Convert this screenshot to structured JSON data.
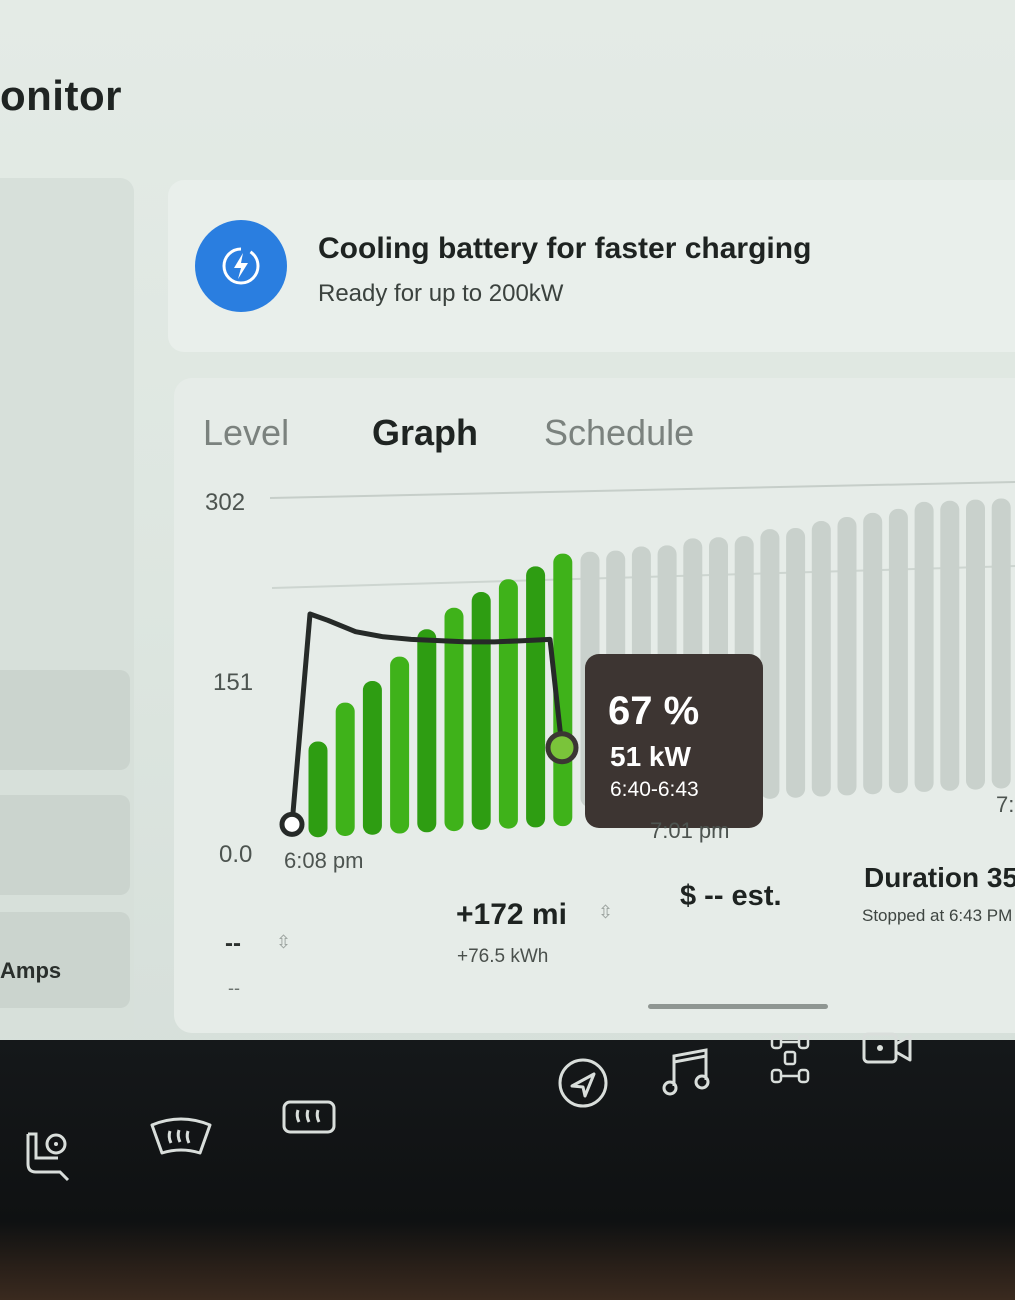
{
  "page": {
    "title": "onitor"
  },
  "sidebar": {
    "amps_label": "Amps"
  },
  "alert": {
    "title": "Cooling battery for faster charging",
    "subtitle": "Ready for up to 200kW",
    "icon": "battery-cooling-icon",
    "icon_color": "#2a7ee0"
  },
  "tabs": [
    {
      "label": "Level",
      "active": false
    },
    {
      "label": "Graph",
      "active": true
    },
    {
      "label": "Schedule",
      "active": false
    }
  ],
  "chart_data": {
    "type": "bar",
    "y_ticks": [
      "302",
      "151",
      "0.0"
    ],
    "ylim": [
      0,
      302
    ],
    "x_tick_labels": [
      "6:08 pm",
      "7:01 pm",
      "7:"
    ],
    "bar_levels_completed": [
      0.33,
      0.46,
      0.53,
      0.61,
      0.7,
      0.77,
      0.82,
      0.86,
      0.9,
      0.94
    ],
    "bar_levels_projected": [
      0.88,
      0.88,
      0.89,
      0.89,
      0.91,
      0.91,
      0.91,
      0.93,
      0.93,
      0.95,
      0.96,
      0.97,
      0.98,
      1.0,
      1.0,
      1.0,
      1.0,
      1.0,
      1.0
    ],
    "power_curve_kw": [
      0,
      166,
      160,
      150,
      145,
      142,
      140,
      138,
      137,
      137,
      137,
      51
    ],
    "colors": {
      "completed": "#3fb21a",
      "completed_dark": "#2e9d12",
      "projected": "#c9d1cc",
      "line": "#262a28"
    },
    "tooltip": {
      "percent": "67 %",
      "power": "51 kW",
      "time": "6:40-6:43"
    }
  },
  "stats": {
    "current_value": "--",
    "current_sub": "--",
    "range_added": "+172 mi",
    "energy_added": "+76.5 kWh",
    "cost": "$ -- est.",
    "duration": "Duration 35",
    "stopped": "Stopped at 6:43 PM"
  },
  "dock": {
    "icons": [
      "navigate-icon",
      "music-icon",
      "apps-icon",
      "dashcam-icon",
      "seat-fan-icon",
      "front-defrost-icon",
      "rear-defrost-icon"
    ]
  }
}
